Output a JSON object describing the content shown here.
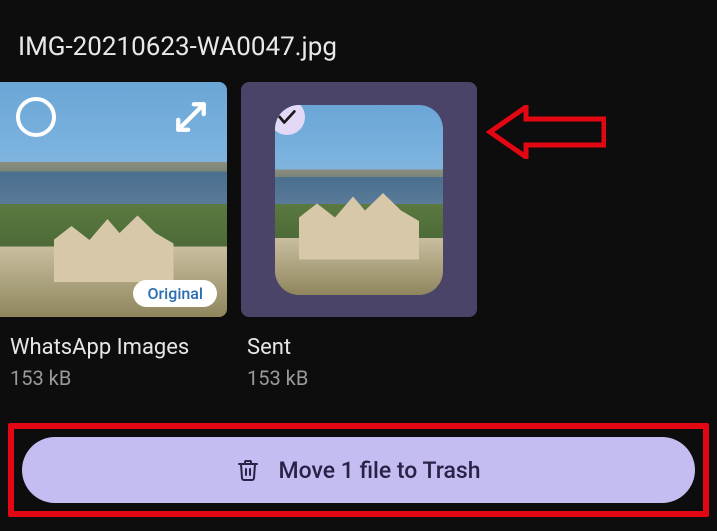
{
  "header": {
    "title": "IMG-20210623-WA0047.jpg"
  },
  "thumbs": [
    {
      "name": "WhatsApp Images",
      "size": "153 kB",
      "chip": "Original",
      "selected": false
    },
    {
      "name": "Sent",
      "size": "153 kB",
      "selected": true
    }
  ],
  "action": {
    "label": "Move 1 file to Trash"
  },
  "icons": {
    "select_circle": "select-circle-icon",
    "expand": "expand-icon",
    "check": "check-icon",
    "trash": "trash-icon",
    "arrow_annotation": "arrow-left-icon"
  }
}
